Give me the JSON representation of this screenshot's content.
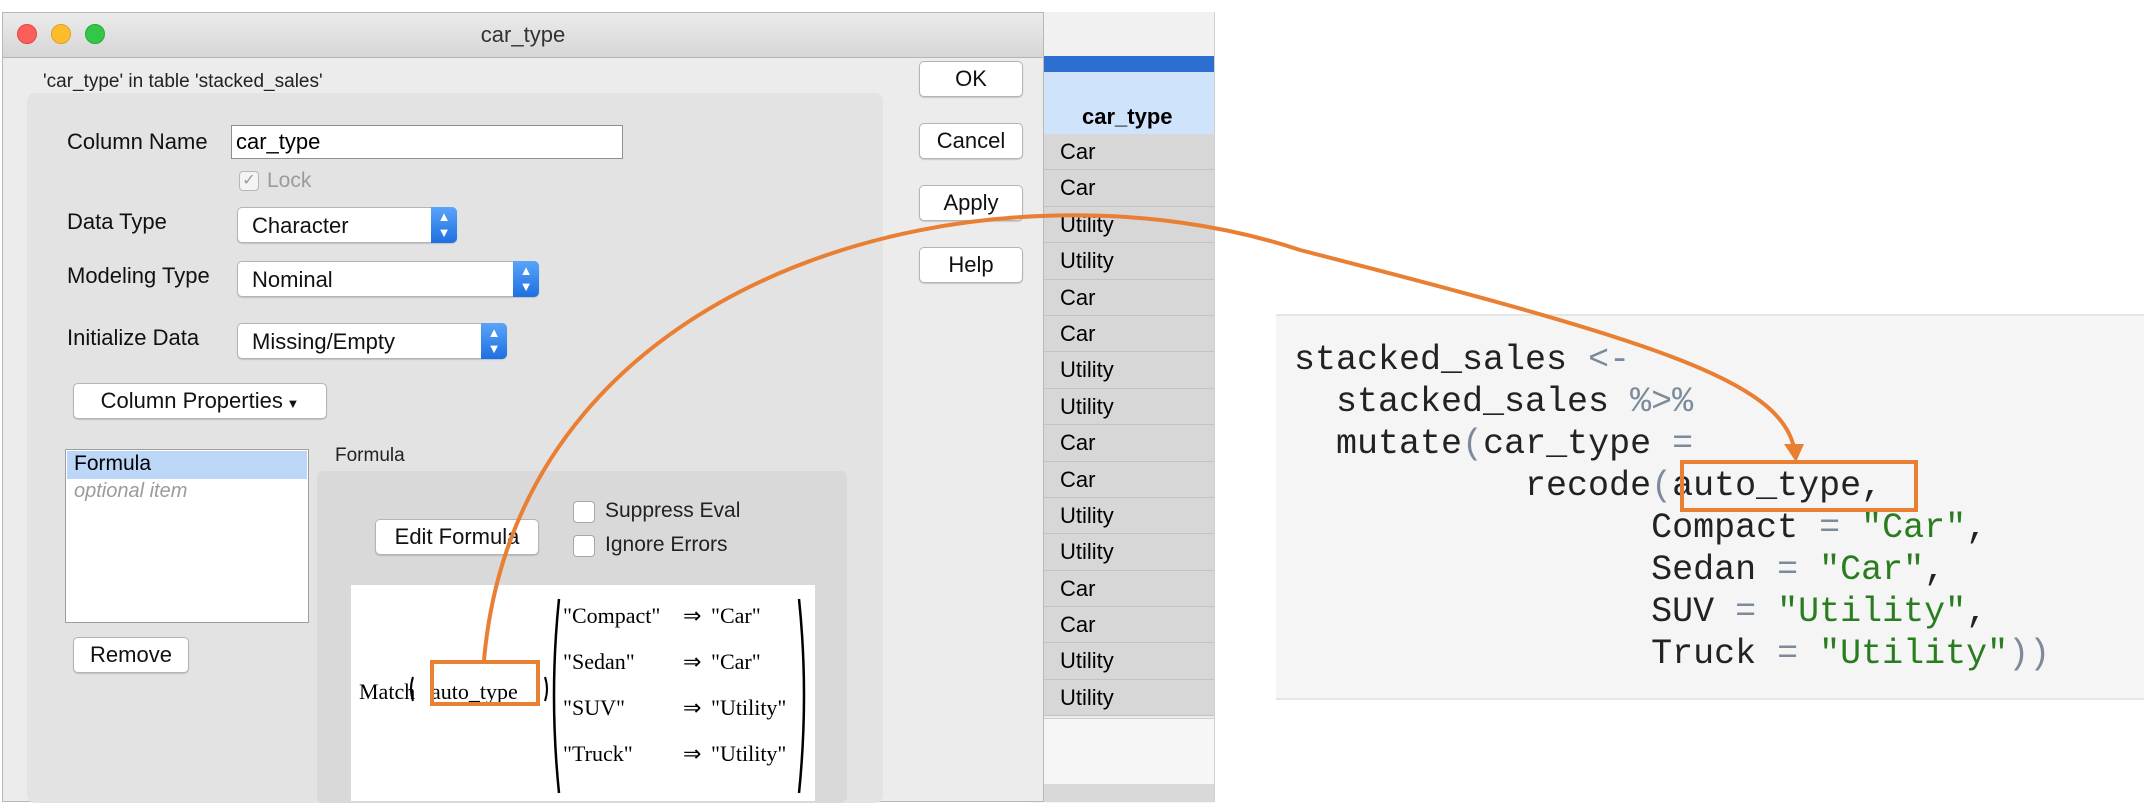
{
  "window": {
    "title": "car_type",
    "subtitle": "'car_type' in table 'stacked_sales'"
  },
  "buttons": {
    "ok": "OK",
    "cancel": "Cancel",
    "apply": "Apply",
    "help": "Help"
  },
  "form": {
    "column_name_label": "Column Name",
    "column_name_value": "car_type",
    "lock_label": "Lock",
    "data_type_label": "Data Type",
    "data_type_value": "Character",
    "modeling_type_label": "Modeling Type",
    "modeling_type_value": "Nominal",
    "init_data_label": "Initialize Data",
    "init_data_value": "Missing/Empty",
    "column_properties_button": "Column Properties",
    "props_items": [
      "Formula",
      "optional item"
    ],
    "remove_button": "Remove",
    "formula_section_label": "Formula",
    "edit_formula_button": "Edit Formula",
    "suppress_eval_label": "Suppress Eval",
    "ignore_errors_label": "Ignore Errors"
  },
  "formula_render": {
    "match_label": "Match",
    "argument": "auto_type",
    "rows": [
      {
        "key": "\"Compact\"",
        "arrow": "⇒",
        "value": "\"Car\""
      },
      {
        "key": "\"Sedan\"",
        "arrow": "⇒",
        "value": "\"Car\""
      },
      {
        "key": "\"SUV\"",
        "arrow": "⇒",
        "value": "\"Utility\""
      },
      {
        "key": "\"Truck\"",
        "arrow": "⇒",
        "value": "\"Utility\""
      }
    ]
  },
  "data_table": {
    "column_header": "car_type",
    "cells": [
      "Car",
      "Car",
      "Utility",
      "Utility",
      "Car",
      "Car",
      "Utility",
      "Utility",
      "Car",
      "Car",
      "Utility",
      "Utility",
      "Car",
      "Car",
      "Utility",
      "Utility"
    ]
  },
  "code": {
    "line1_a": "stacked_sales",
    "line1_op": "<-",
    "line2_a": "stacked_sales",
    "line2_op": "%>%",
    "line3_fn": "mutate",
    "line3_paren": "(",
    "line3_var": "car_type",
    "line3_op": "=",
    "line4_fn": "recode",
    "line4_paren": "(",
    "line4_arg": "auto_type,",
    "pairs": [
      {
        "name": "Compact",
        "op": "=",
        "value": "\"Car\"",
        "tail": ","
      },
      {
        "name": "Sedan",
        "op": "=",
        "value": "\"Car\"",
        "tail": ","
      },
      {
        "name": "SUV",
        "op": "=",
        "value": "\"Utility\"",
        "tail": ","
      },
      {
        "name": "Truck",
        "op": "=",
        "value": "\"Utility\"",
        "tail": "))"
      }
    ]
  },
  "colors": {
    "highlight": "#e97f33",
    "string": "#2a7d1f",
    "selection": "#bcd6f7",
    "stepper": "#1e6fe2"
  },
  "icons": [
    "close-light-icon",
    "minimize-light-icon",
    "zoom-light-icon",
    "checkmark-icon",
    "stepper-arrows-icon",
    "dropdown-triangle-icon",
    "curved-arrow-icon"
  ]
}
